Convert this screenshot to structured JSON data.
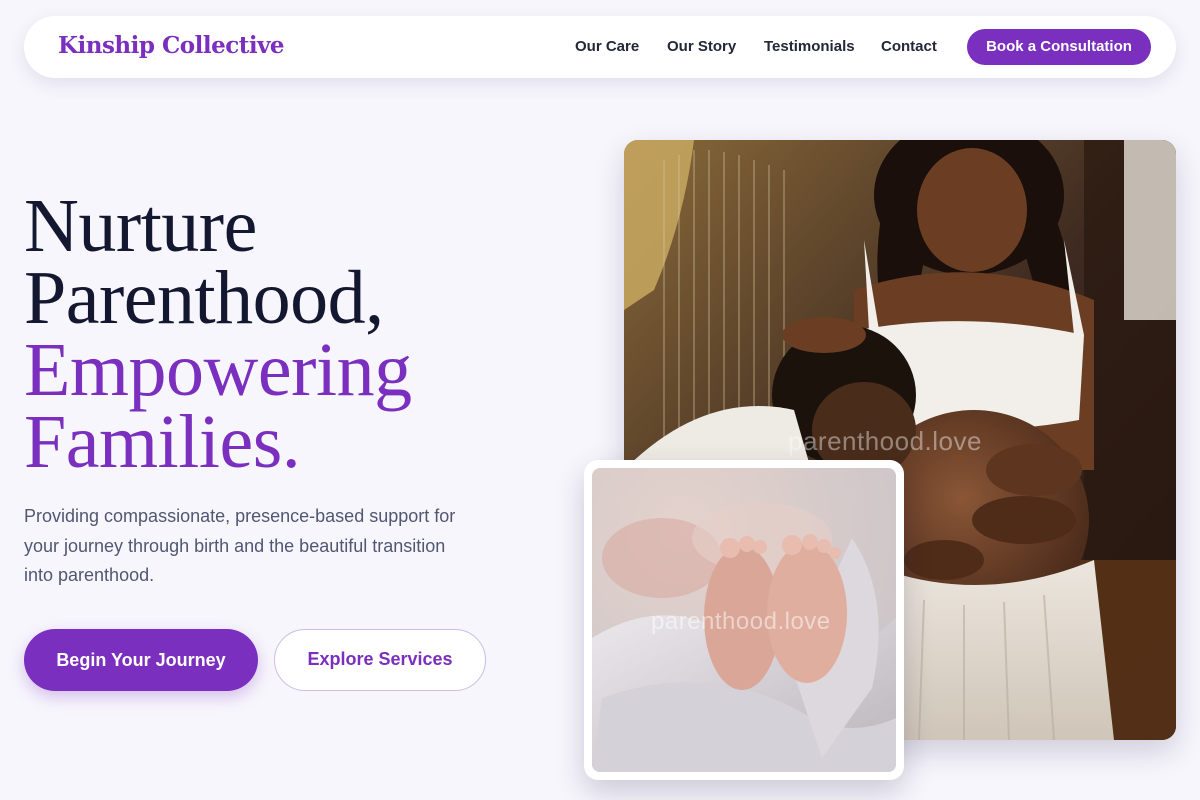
{
  "nav": {
    "brand": "Kinship Collective",
    "links": [
      "Our Care",
      "Our Story",
      "Testimonials",
      "Contact"
    ],
    "cta": "Book a Consultation"
  },
  "hero": {
    "headline_lines": [
      "Nurture",
      "Parenthood,"
    ],
    "headline_accent_lines": [
      "Empowering",
      "Families."
    ],
    "subtitle": "Providing compassionate, presence-based support for your journey through birth and the beautiful transition into parenthood.",
    "primary_button": "Begin Your Journey",
    "secondary_button": "Explore Services"
  },
  "images": {
    "main_watermark": "parenthood.love",
    "inset_watermark": "parenthood.love"
  },
  "colors": {
    "accent": "#7a2fbe",
    "background": "#f7f6fc",
    "headline": "#141730",
    "body_text": "#515772"
  }
}
